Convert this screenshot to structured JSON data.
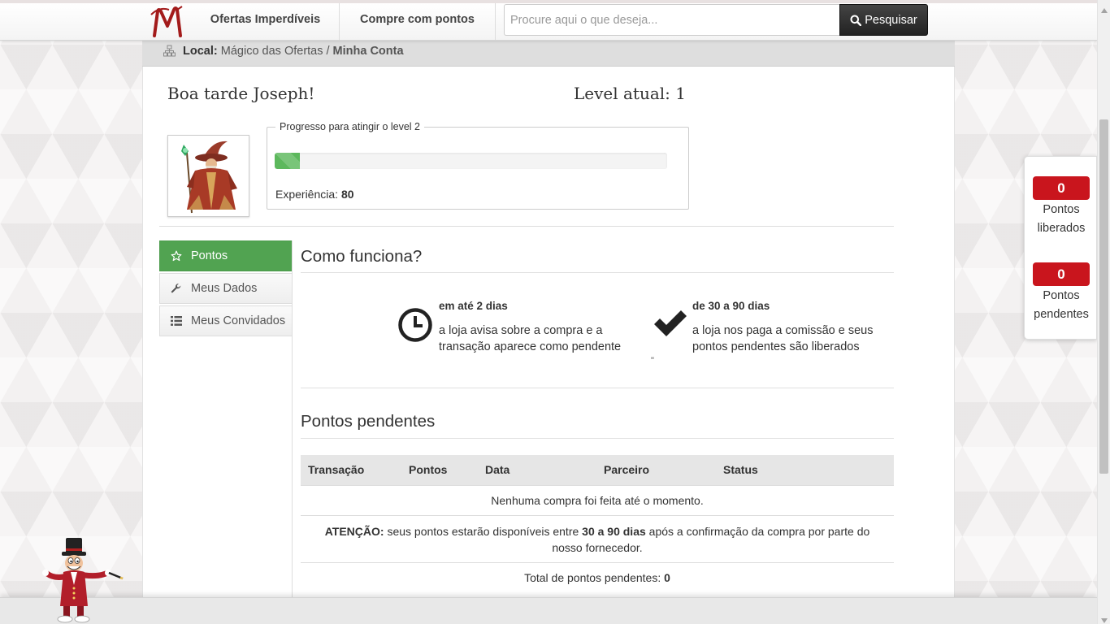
{
  "header": {
    "logo_alt": "M",
    "nav": [
      "Ofertas Imperdíveis",
      "Compre com pontos"
    ],
    "search_placeholder": "Procure aqui o que deseja...",
    "search_button": "Pesquisar"
  },
  "breadcrumb": {
    "label": "Local:",
    "items": [
      "Mágico das Ofertas",
      "Minha Conta"
    ],
    "separator": "/"
  },
  "profile": {
    "greeting": "Boa tarde Joseph!",
    "level_label": "Level atual: 1",
    "progress_legend": "Progresso para atingir o level 2",
    "progress_fraction": 0.065,
    "xp_label": "Experiência:",
    "xp_value": "80"
  },
  "sidebar": {
    "items": [
      {
        "label": "Pontos",
        "icon": "star-icon",
        "active": true
      },
      {
        "label": "Meus Dados",
        "icon": "wrench-icon",
        "active": false
      },
      {
        "label": "Meus Convidados",
        "icon": "list-icon",
        "active": false
      }
    ]
  },
  "como_funciona": {
    "title": "Como funciona?",
    "steps": [
      {
        "title": "em até 2 dias",
        "line1": "a loja avisa sobre a compra e a",
        "line2": "transação aparece como pendente",
        "icon": "clock-icon"
      },
      {
        "title": "de 30 a 90 dias",
        "line1": "a loja nos paga a comissão e seus",
        "line2": "pontos pendentes são liberados",
        "icon": "check-icon"
      }
    ],
    "stray_mark": "\""
  },
  "pendentes": {
    "title": "Pontos pendentes",
    "columns": [
      "Transação",
      "Pontos",
      "Data",
      "Parceiro",
      "Status"
    ],
    "empty_message": "Nenhuma compra foi feita até o momento.",
    "notice_label": "ATENÇÃO:",
    "notice_text_1": "seus pontos estarão disponíveis entre",
    "notice_bold": "30 a 90 dias",
    "notice_text_2": "após a confirmação da compra por parte do nosso fornecedor.",
    "total_label": "Total de pontos pendentes:",
    "total_value": "0"
  },
  "right_panel": {
    "liberados_value": "0",
    "liberados_line1": "Pontos",
    "liberados_line2": "liberados",
    "pendentes_value": "0",
    "pendentes_line1": "Pontos",
    "pendentes_line2": "pendentes"
  },
  "colors": {
    "brand_red": "#c9151d",
    "active_green": "#51a351",
    "progress_green": "#5cb85c"
  }
}
